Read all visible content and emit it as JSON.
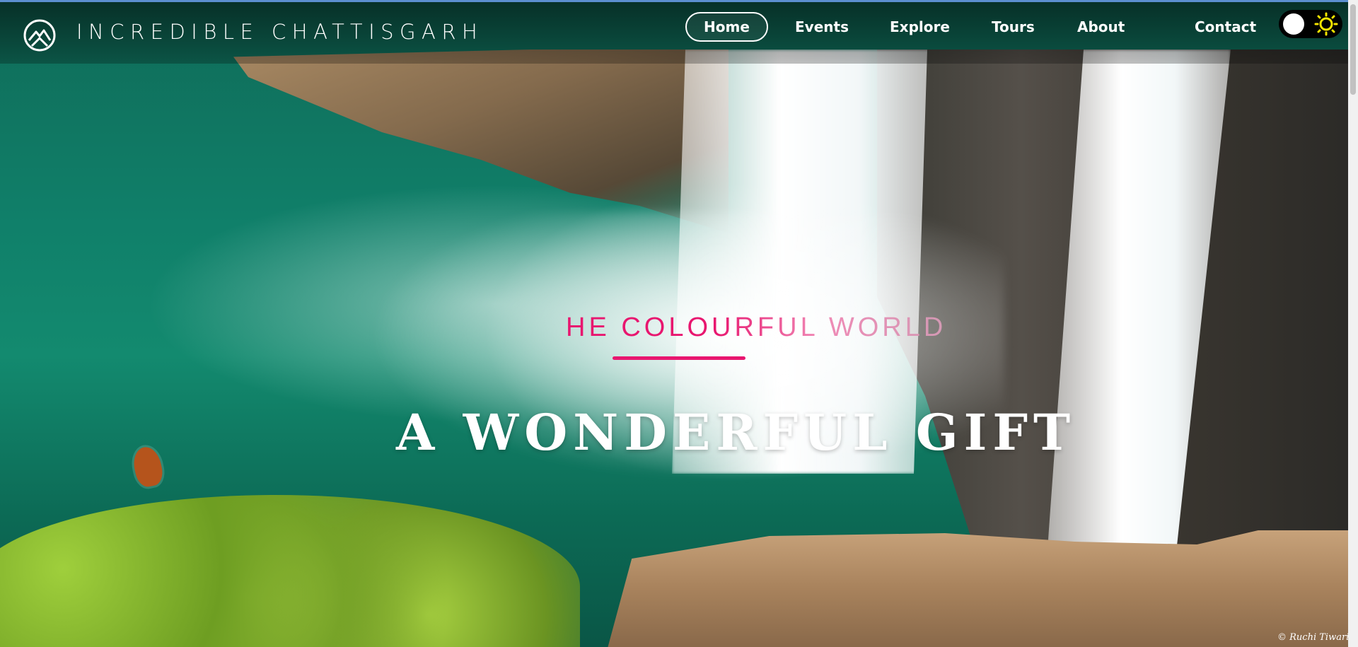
{
  "brand": {
    "name": "INCREDIBLE CHATTISGARH",
    "logo_icon": "mountain-circle-logo-icon"
  },
  "nav": {
    "items": [
      {
        "label": "Home",
        "active": true
      },
      {
        "label": "Events",
        "active": false
      },
      {
        "label": "Explore",
        "active": false
      },
      {
        "label": "Tours",
        "active": false
      },
      {
        "label": "About",
        "active": false
      },
      {
        "label": "Contact",
        "active": false
      }
    ]
  },
  "theme_toggle": {
    "icon": "sun-icon",
    "sun_color": "#f5e400"
  },
  "hero": {
    "tagline": "HE COLOURFUL WORLD",
    "title": "A WONDERFUL GIFT",
    "accent_color": "#e8166f",
    "photo_credit": "© Ruchi Tiwari"
  }
}
